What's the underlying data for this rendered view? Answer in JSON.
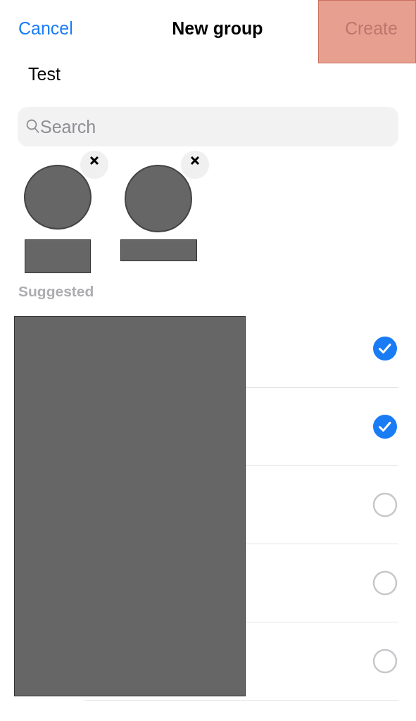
{
  "nav_bar": {
    "cancel": "Cancel",
    "title": "New group",
    "create": {
      "label": "Create",
      "disabled": true,
      "highlighted": true
    }
  },
  "group_name": {
    "value": "Test"
  },
  "search": {
    "placeholder": "Search"
  },
  "members": [
    {
      "removable": true
    },
    {
      "removable": true
    }
  ],
  "suggested": {
    "heading": "Suggested",
    "rows": [
      {
        "checked": true
      },
      {
        "checked": true
      },
      {
        "checked": false
      },
      {
        "checked": false
      },
      {
        "checked": false
      }
    ]
  }
}
